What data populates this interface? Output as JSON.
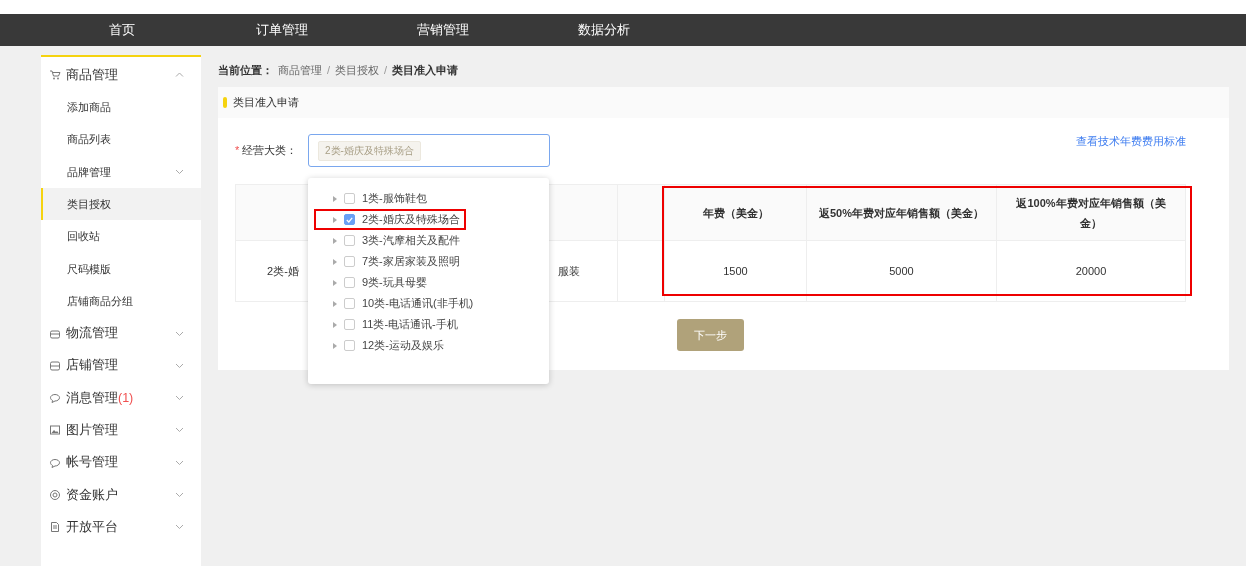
{
  "top_nav": [
    {
      "label": "首页",
      "selected": false
    },
    {
      "label": "订单管理",
      "selected": false
    },
    {
      "label": "营销管理",
      "selected": false
    },
    {
      "label": "数据分析",
      "selected": false
    }
  ],
  "sidebar": [
    {
      "label": "商品管理",
      "expanded": true,
      "children": [
        {
          "label": "添加商品",
          "kind": "link",
          "selected": false
        },
        {
          "label": "商品列表",
          "kind": "link",
          "selected": false
        },
        {
          "label": "品牌管理",
          "kind": "submenu",
          "expanded": false,
          "selected": false
        },
        {
          "label": "类目授权",
          "kind": "link",
          "selected": true
        },
        {
          "label": "回收站",
          "kind": "link",
          "selected": false
        },
        {
          "label": "尺码模版",
          "kind": "link",
          "selected": false
        },
        {
          "label": "店铺商品分组",
          "kind": "link",
          "selected": false
        }
      ]
    },
    {
      "label": "物流管理",
      "expanded": false
    },
    {
      "label": "店铺管理",
      "expanded": false
    },
    {
      "label": "消息管理",
      "badge": "(1)",
      "expanded": false
    },
    {
      "label": "图片管理",
      "expanded": false
    },
    {
      "label": "帐号管理",
      "expanded": false
    },
    {
      "label": "资金账户",
      "expanded": false
    },
    {
      "label": "开放平台",
      "expanded": false
    }
  ],
  "breadcrumb": {
    "prefix": "当前位置：",
    "items": [
      "商品管理",
      "类目授权",
      "类目准入申请"
    ],
    "separator": "/"
  },
  "panel_title": "类目准入申请",
  "form": {
    "label": "经营大类：",
    "required_mark": "*",
    "selected_tags": [
      "2类-婚庆及特殊场合"
    ],
    "link": "查看技术年费费用标准"
  },
  "dropdown": {
    "options": [
      {
        "label": "1类-服饰鞋包",
        "checked": false,
        "annotated": false
      },
      {
        "label": "2类-婚庆及特殊场合",
        "checked": true,
        "annotated": true
      },
      {
        "label": "3类-汽摩相关及配件",
        "checked": false,
        "annotated": false
      },
      {
        "label": "7类-家居家装及照明",
        "checked": false,
        "annotated": false
      },
      {
        "label": "9类-玩具母婴",
        "checked": false,
        "annotated": false
      },
      {
        "label": "10类-电话通讯(非手机)",
        "checked": false,
        "annotated": false
      },
      {
        "label": "11类-电话通讯-手机",
        "checked": false,
        "annotated": false
      },
      {
        "label": "12类-运动及娱乐",
        "checked": false,
        "annotated": false
      }
    ]
  },
  "table": {
    "columns": [
      {
        "annotated": false
      },
      {
        "annotated": false
      },
      {
        "annotated": false
      },
      {
        "label": "年费（美金）",
        "annotated": true
      },
      {
        "label": "返50%年费对应年销售额（美金）",
        "annotated": true
      },
      {
        "label": "返100%年费对应年销售额（美金）",
        "annotated": true
      }
    ],
    "rows": [
      [
        "2类-婚",
        "服装",
        null,
        "1500",
        "5000",
        "20000"
      ]
    ]
  },
  "next_button": "下一步"
}
